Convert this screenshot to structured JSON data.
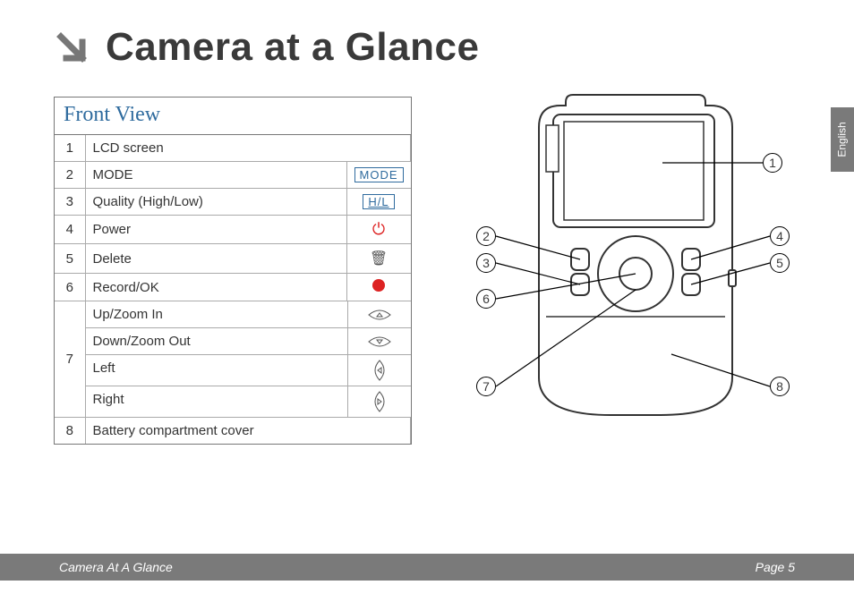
{
  "title": "Camera at a Glance",
  "section_title": "Front View",
  "language_tab": "English",
  "footer": {
    "left": "Camera At A Glance",
    "right": "Page 5"
  },
  "rows": [
    {
      "num": "1",
      "label": "LCD screen",
      "icon": ""
    },
    {
      "num": "2",
      "label": "MODE",
      "icon": "MODE"
    },
    {
      "num": "3",
      "label": "Quality (High/Low)",
      "icon": "H/L"
    },
    {
      "num": "4",
      "label": "Power",
      "icon": "power"
    },
    {
      "num": "5",
      "label": "Delete",
      "icon": "trash"
    },
    {
      "num": "6",
      "label": "Record/OK",
      "icon": "record"
    }
  ],
  "row7": {
    "num": "7",
    "items": [
      {
        "label": "Up/Zoom In",
        "dir": "up"
      },
      {
        "label": "Down/Zoom Out",
        "dir": "down"
      },
      {
        "label": "Left",
        "dir": "left"
      },
      {
        "label": "Right",
        "dir": "right"
      }
    ]
  },
  "row8": {
    "num": "8",
    "label": "Battery compartment cover"
  },
  "callouts": [
    "1",
    "2",
    "3",
    "4",
    "5",
    "6",
    "7",
    "8"
  ]
}
